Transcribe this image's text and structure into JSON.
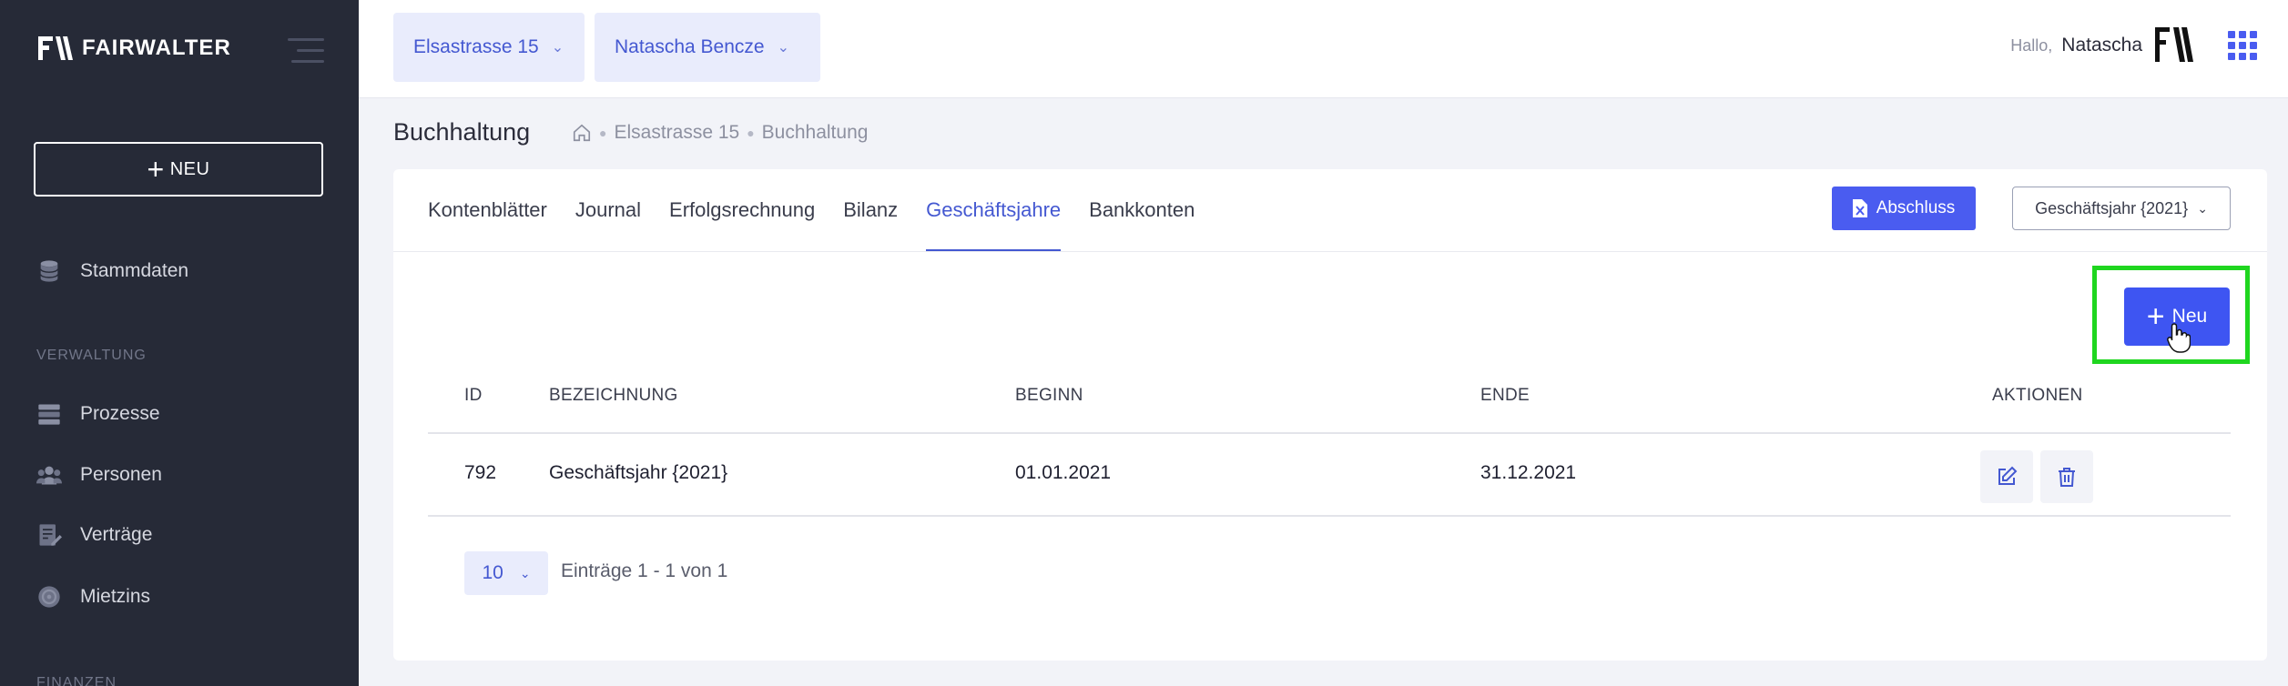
{
  "brand": {
    "name": "FAIRWALTER"
  },
  "sidebar": {
    "new_label": "NEU",
    "items": [
      {
        "label": "Stammdaten",
        "icon": "database-icon"
      },
      {
        "label": "Prozesse",
        "icon": "process-icon"
      },
      {
        "label": "Personen",
        "icon": "people-icon"
      },
      {
        "label": "Verträge",
        "icon": "contract-icon"
      },
      {
        "label": "Mietzins",
        "icon": "rent-icon"
      }
    ],
    "sections": [
      "VERWALTUNG",
      "FINANZEN"
    ]
  },
  "topbar": {
    "property": "Elsastrasse 15",
    "user_select": "Natascha Bencze",
    "greeting": "Hallo,",
    "user_name": "Natascha"
  },
  "page": {
    "title": "Buchhaltung",
    "breadcrumb": [
      "Elsastrasse 15",
      "Buchhaltung"
    ]
  },
  "tabs": [
    "Kontenblätter",
    "Journal",
    "Erfolgsrechnung",
    "Bilanz",
    "Geschäftsjahre",
    "Bankkonten"
  ],
  "active_tab": "Geschäftsjahre",
  "toolbar": {
    "abschluss_label": "Abschluss",
    "year_select": "Geschäftsjahr {2021}",
    "neu_label": "Neu"
  },
  "table": {
    "columns": [
      "ID",
      "BEZEICHNUNG",
      "BEGINN",
      "ENDE",
      "AKTIONEN"
    ],
    "rows": [
      {
        "id": "792",
        "bezeichnung": "Geschäftsjahr {2021}",
        "beginn": "01.01.2021",
        "ende": "31.12.2021"
      }
    ]
  },
  "pagination": {
    "per_page": "10",
    "entries": "Einträge 1 - 1 von 1"
  },
  "colors": {
    "accent": "#4a5cf0",
    "sidebar": "#262a37",
    "highlight": "#1fd61f"
  }
}
